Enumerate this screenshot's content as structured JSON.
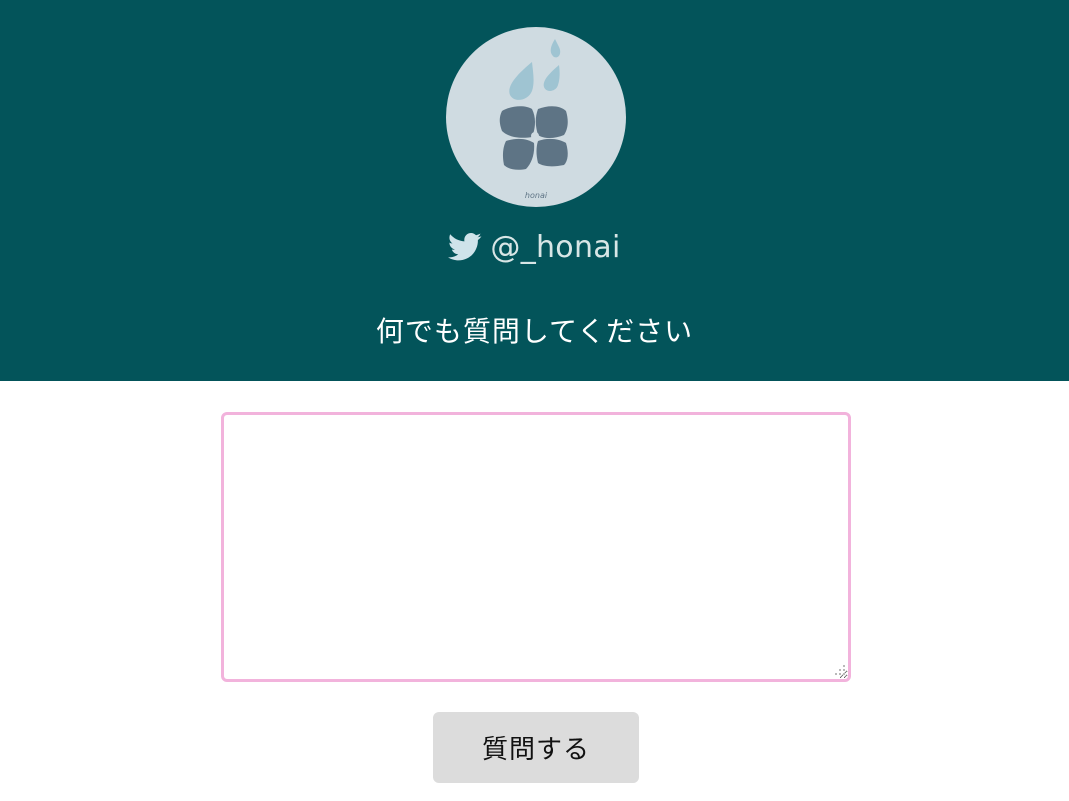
{
  "profile": {
    "avatar_label": "honai",
    "handle": "@_honai"
  },
  "form": {
    "prompt": "何でも質問してください",
    "question_value": "",
    "submit_label": "質問する"
  },
  "icons": {
    "social": "twitter-icon",
    "avatar": "hydrangea-rain-icon"
  },
  "colors": {
    "header_bg": "#03545a",
    "avatar_bg": "#cfdbe1",
    "textarea_border": "#f2b3dc",
    "button_bg": "#dcdcdc"
  }
}
